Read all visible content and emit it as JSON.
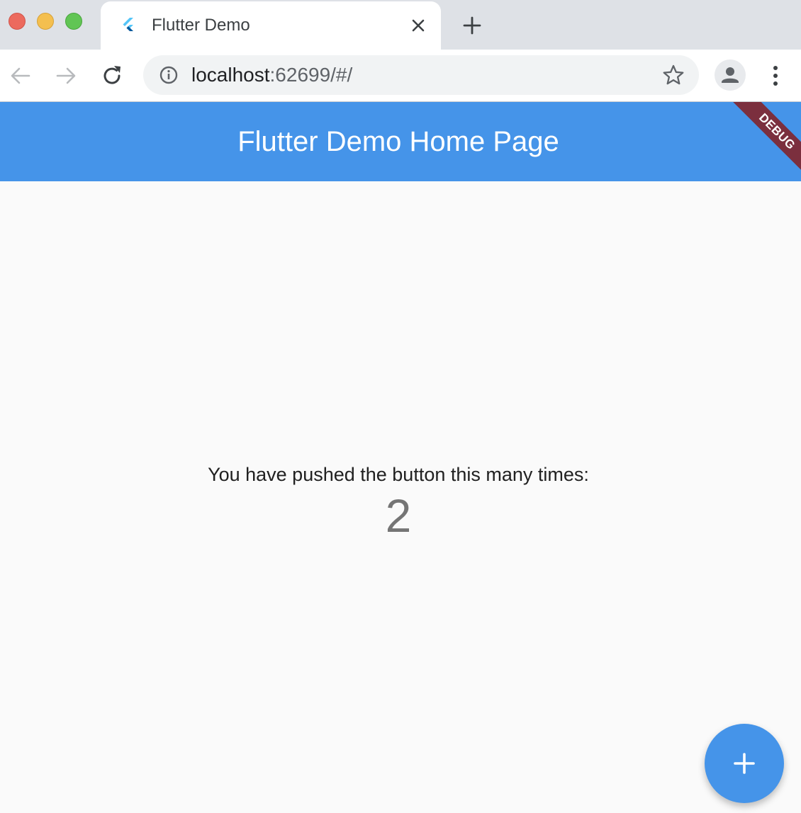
{
  "browser": {
    "tab": {
      "title": "Flutter Demo",
      "favicon": "flutter-logo-icon"
    },
    "address": {
      "host": "localhost",
      "rest": ":62699/#/"
    },
    "icons": {
      "back": "arrow-left-icon",
      "forward": "arrow-right-icon",
      "reload": "reload-icon",
      "info": "info-icon",
      "star": "star-icon",
      "profile": "person-icon",
      "menu": "more-vert-icon",
      "close_tab": "close-icon",
      "new_tab": "plus-icon"
    },
    "colors": {
      "tab_strip": "#dee1e6",
      "close": "#ec6a5e",
      "minimize": "#f4bf4f",
      "maximize": "#61c554"
    }
  },
  "app": {
    "app_bar": {
      "title": "Flutter Demo Home Page"
    },
    "debug_banner": "DEBUG",
    "counter": {
      "label": "You have pushed the button this many times:",
      "value": "2"
    },
    "fab": {
      "icon": "plus-icon"
    },
    "colors": {
      "primary": "#4594e9",
      "debug_banner": "#7b2f3e",
      "background": "#fafafa"
    }
  }
}
